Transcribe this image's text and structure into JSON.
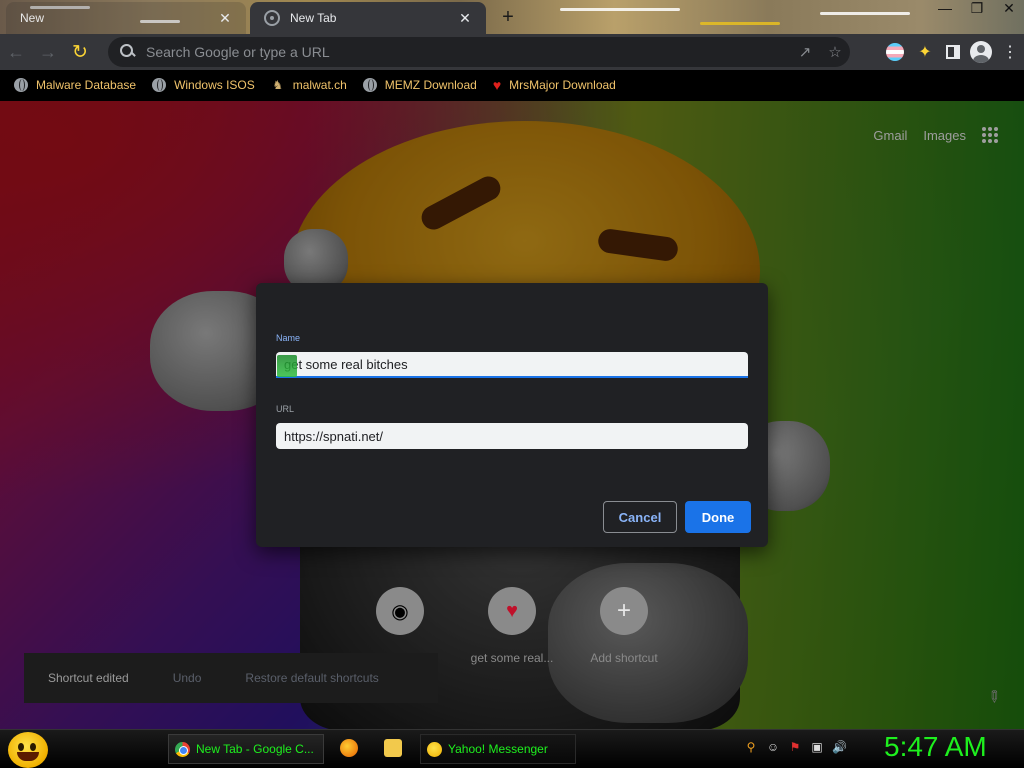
{
  "browser": {
    "tabs": [
      {
        "title": "New",
        "active": false
      },
      {
        "title": "New Tab",
        "active": true
      }
    ],
    "new_tab_symbol": "+",
    "tab_close_symbol": "✕",
    "window_controls": [
      "—",
      "❐",
      "✕"
    ],
    "omnibox_placeholder": "Search Google or type a URL",
    "bookmarks": [
      {
        "label": "Malware Database",
        "icon": "globe-icon"
      },
      {
        "label": "Windows ISOS",
        "icon": "globe-icon"
      },
      {
        "label": "malwat.ch",
        "icon": "person-icon"
      },
      {
        "label": "MEMZ Download",
        "icon": "globe-icon"
      },
      {
        "label": "MrsMajor Download",
        "icon": "heart-icon"
      }
    ]
  },
  "ntp": {
    "links": {
      "gmail": "Gmail",
      "images": "Images"
    },
    "shortcuts": [
      {
        "label": "",
        "icon": "raccoon-icon"
      },
      {
        "label": "get some real...",
        "icon": "heart-icon"
      },
      {
        "label": "Add shortcut",
        "icon": "plus-icon"
      }
    ],
    "toast": {
      "message": "Shortcut edited",
      "undo": "Undo",
      "restore": "Restore default shortcuts"
    }
  },
  "dialog": {
    "name_label": "Name",
    "name_value": "get some real bitches",
    "url_label": "URL",
    "url_value": "https://spnati.net/",
    "cancel": "Cancel",
    "done": "Done"
  },
  "taskbar": {
    "tasks": [
      {
        "label": "New Tab - Google C...",
        "icon": "chrome-icon"
      },
      {
        "label": "Yahoo! Messenger",
        "icon": "yahoo-messenger-icon"
      }
    ],
    "clock": "5:47 AM"
  },
  "colors": {
    "bookmark_text": "#f0c36b",
    "accent_blue": "#1a73e8",
    "taskbar_text": "#1ef01e"
  }
}
